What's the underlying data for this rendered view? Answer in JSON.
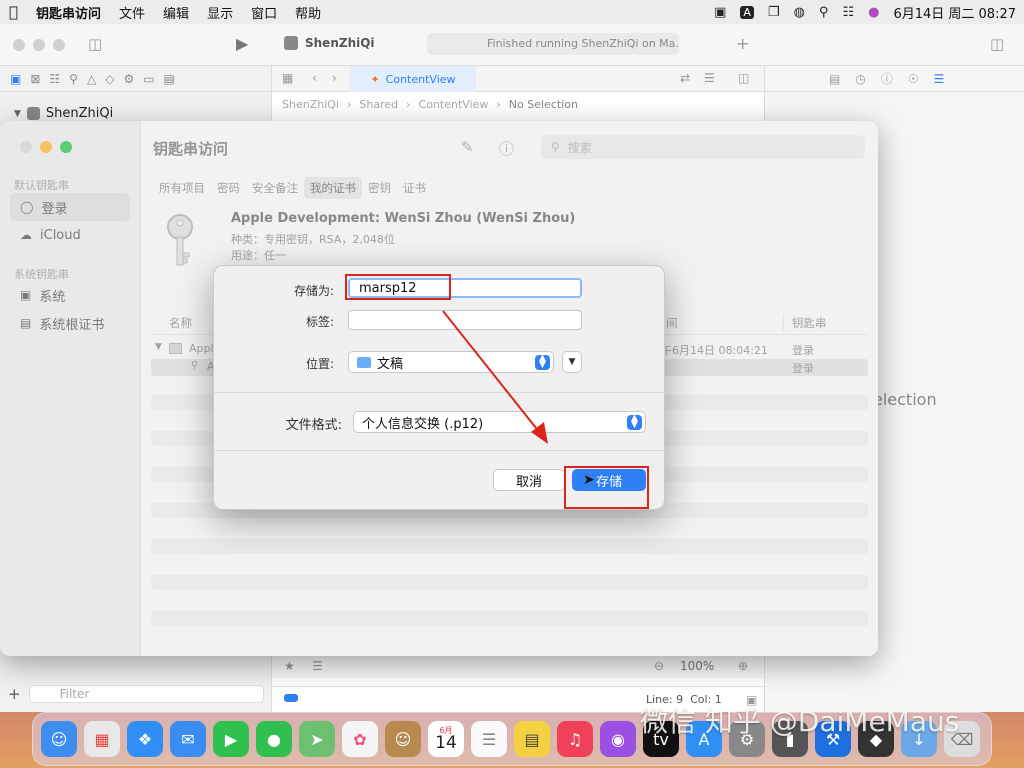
{
  "menubar": {
    "app_name": "钥匙串访问",
    "items": [
      "文件",
      "编辑",
      "显示",
      "窗口",
      "帮助"
    ],
    "datetime": "6月14日 周二 08:27"
  },
  "xcode": {
    "project_name": "ShenZhiQi",
    "status": "Finished running ShenZhiQi on Ma...",
    "tab": "ContentView",
    "breadcrumb": [
      "ShenZhiQi",
      "Shared",
      "ContentView",
      "No Selection"
    ],
    "sidebar_root": "ShenZhiQi",
    "inspector_text": "election",
    "zoom": "100%",
    "filter_placeholder": "Filter",
    "cursor_pos": "Line: 9  Col: 1"
  },
  "keychain": {
    "title": "钥匙串访问",
    "search_placeholder": "搜索",
    "sidebar": {
      "default_header": "默认钥匙串",
      "default_items": [
        "登录",
        "iCloud"
      ],
      "system_header": "系统钥匙串",
      "system_items": [
        "系统",
        "系统根证书"
      ]
    },
    "tabs": [
      "所有项目",
      "密码",
      "安全备注",
      "我的证书",
      "密钥",
      "证书"
    ],
    "selected_tab": "我的证书",
    "cert": {
      "name": "Apple Development: WenSi Zhou (WenSi Zhou)",
      "kind": "种类：专用密钥，RSA，2,048位",
      "usage": "用途：任一"
    },
    "columns": {
      "name": "名称",
      "date": "间",
      "keychain": "钥匙串"
    },
    "rows": [
      {
        "name": "Appl",
        "date": "午6月14日 08:04:21",
        "keychain": "登录"
      },
      {
        "name": "A",
        "date": "",
        "keychain": "登录"
      }
    ]
  },
  "dialog": {
    "save_as_label": "存储为:",
    "save_as_value": "marsp12",
    "tags_label": "标签:",
    "location_label": "位置:",
    "location_value": "文稿",
    "format_label": "文件格式:",
    "format_value": "个人信息交换 (.p12)",
    "cancel_label": "取消",
    "save_label": "存储"
  },
  "dock": {
    "calendar_month": "6月",
    "calendar_day": "14"
  },
  "watermark": "微信 知乎 @DaiMeMaus",
  "colors": {
    "accent": "#2f7ff7",
    "annotation": "#d9261c"
  }
}
